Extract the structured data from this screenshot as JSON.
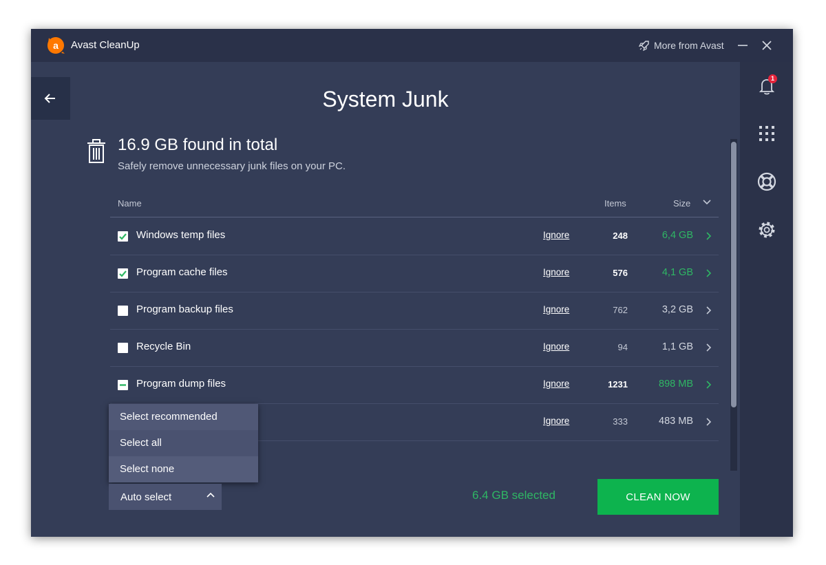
{
  "titlebar": {
    "app_title": "Avast CleanUp",
    "more_label": "More from Avast",
    "minimize_icon": "minimize-icon",
    "close_icon": "close-icon"
  },
  "sidebar": {
    "notification_count": "1",
    "icons": [
      "bell-icon",
      "apps-grid-icon",
      "help-lifebuoy-icon",
      "gear-icon"
    ]
  },
  "page": {
    "title": "System Junk",
    "found_total": "16.9 GB found in total",
    "subtitle": "Safely remove unnecessary junk files on your PC."
  },
  "table": {
    "headers": {
      "name": "Name",
      "items": "Items",
      "size": "Size"
    },
    "ignore_label": "Ignore",
    "rows": [
      {
        "name": "Windows temp files",
        "items": "248",
        "size": "6,4 GB",
        "state": "checked"
      },
      {
        "name": "Program cache files",
        "items": "576",
        "size": "4,1 GB",
        "state": "checked"
      },
      {
        "name": "Program backup files",
        "items": "762",
        "size": "3,2 GB",
        "state": "unchecked"
      },
      {
        "name": "Recycle Bin",
        "items": "94",
        "size": "1,1 GB",
        "state": "unchecked"
      },
      {
        "name": "Program dump files",
        "items": "1231",
        "size": "898 MB",
        "state": "partial"
      },
      {
        "name": "",
        "items": "333",
        "size": "483 MB",
        "state": "hidden"
      }
    ]
  },
  "dropdown": {
    "items": [
      "Select recommended",
      "Select all",
      "Select none"
    ],
    "auto_select_label": "Auto select"
  },
  "footer": {
    "selected_text": "6.4 GB selected",
    "clean_button": "CLEAN NOW"
  },
  "colors": {
    "accent_green": "#0db34e",
    "selected_green": "#2fb764",
    "background": "#343d57",
    "titlebar": "#2a3149",
    "logo_orange": "#ff7800",
    "badge_red": "#e5243b"
  }
}
